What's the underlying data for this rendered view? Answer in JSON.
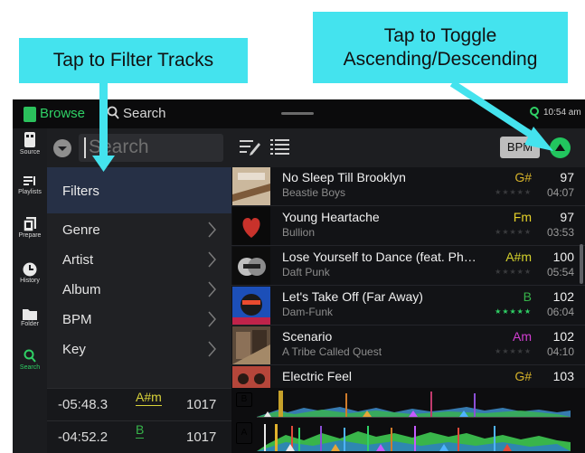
{
  "callouts": {
    "filter": "Tap to Filter Tracks",
    "sort_line1": "Tap to Toggle",
    "sort_line2": "Ascending/Descending"
  },
  "topbar": {
    "browse": "Browse",
    "search": "Search",
    "clock": "10:54 am"
  },
  "nav": [
    {
      "label": "Source",
      "icon": "drive-icon"
    },
    {
      "label": "Playlists",
      "icon": "playlists-icon"
    },
    {
      "label": "Prepare",
      "icon": "prepare-icon"
    },
    {
      "label": "History",
      "icon": "history-clock-icon"
    },
    {
      "label": "Folder",
      "icon": "folder-icon"
    },
    {
      "label": "Search",
      "icon": "search-icon",
      "active": true
    }
  ],
  "toolbar": {
    "search_placeholder": "Search",
    "bpm": "BPM"
  },
  "filters": {
    "header": "Filters",
    "items": [
      "Genre",
      "Artist",
      "Album",
      "BPM",
      "Key"
    ]
  },
  "decks": [
    {
      "time": "-05:48.3",
      "key": "A#m",
      "bpm": "1017"
    },
    {
      "time": "-04:52.2",
      "key": "B",
      "bpm": "1017"
    }
  ],
  "tracks": [
    {
      "title": "No Sleep Till Brooklyn",
      "artist": "Beastie Boys",
      "key": "G#",
      "key_color": "#d6b32a",
      "bpm": "97",
      "time": "04:07",
      "stars": "★★★★★",
      "rated": false
    },
    {
      "title": "Young Heartache",
      "artist": "Bullion",
      "key": "Fm",
      "key_color": "#e6d229",
      "bpm": "97",
      "time": "03:53",
      "stars": "★★★★★",
      "rated": false
    },
    {
      "title": "Lose Yourself to Dance (feat. Ph…",
      "artist": "Daft Punk",
      "key": "A#m",
      "key_color": "#d4d12c",
      "bpm": "100",
      "time": "05:54",
      "stars": "★★★★★",
      "rated": false
    },
    {
      "title": "Let's Take Off (Far Away)",
      "artist": "Dam-Funk",
      "key": "B",
      "key_color": "#37b34a",
      "bpm": "102",
      "time": "06:04",
      "stars": "★★★★★",
      "rated": true
    },
    {
      "title": "Scenario",
      "artist": "A Tribe Called Quest",
      "key": "Am",
      "key_color": "#d13ed1",
      "bpm": "102",
      "time": "04:10",
      "stars": "★★★★★",
      "rated": false
    },
    {
      "title": "Electric Feel",
      "artist": "",
      "key": "G#",
      "key_color": "#d6b32a",
      "bpm": "103",
      "time": "",
      "stars": "",
      "rated": false
    }
  ],
  "waveform": {
    "deck_b": "B",
    "deck_a": "A",
    "deck_b_color": "#2f6fe0",
    "deck_a_color": "#22b14c"
  },
  "colors": {
    "accent": "#2fd065",
    "callout": "#44e3ee",
    "filters_header": "#263046"
  }
}
